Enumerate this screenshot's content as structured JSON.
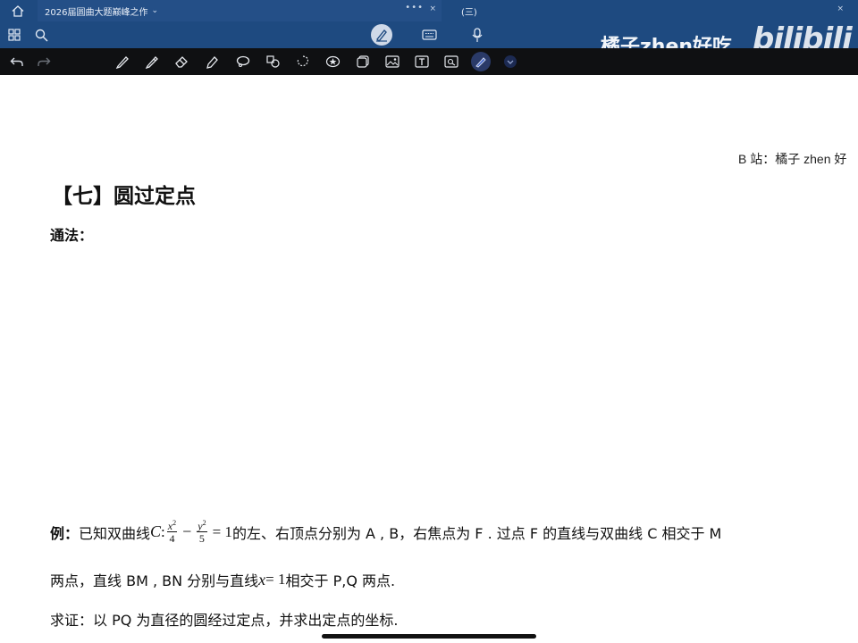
{
  "tabs": {
    "home_icon": "home-icon",
    "doc_title": "2026届圆曲大题巅峰之作",
    "doc_chevron": "⌄",
    "doc_dots": "•••",
    "doc_close": "×",
    "second_title": "(三)",
    "second_close": "×"
  },
  "nav": {
    "grid_icon": "grid-icon",
    "search_icon": "search-icon",
    "pen_mode_icon": "pen-mode-icon",
    "keyboard_icon": "keyboard-icon",
    "mic_icon": "microphone-icon"
  },
  "watermark": {
    "text": "橘子zhen好吃",
    "logo": "bilibili"
  },
  "toolbar": {
    "undo_icon": "undo-icon",
    "redo_icon": "redo-icon",
    "tools": [
      "pen-icon",
      "pencil-icon",
      "eraser-icon",
      "highlighter-icon",
      "lasso-icon",
      "shapes-icon",
      "selection-icon",
      "sticker-icon",
      "element-icon",
      "image-icon",
      "textbox-icon",
      "zoom-window-icon",
      "laser-icon"
    ],
    "colors": {
      "selected": "#1f3f8f",
      "dot_red": "#c0392b",
      "dot_blue": "#2e3f9a"
    }
  },
  "page": {
    "credit": "B 站：橘子 zhen 好",
    "section_title": "【七】圆过定点",
    "method_label": "通法：",
    "example": {
      "label": "例：",
      "line1_pre": "已知双曲线",
      "curve_name": "C",
      "colon": ":",
      "frac1_num": "x",
      "frac1_exp": "2",
      "frac1_den": "4",
      "minus": "−",
      "frac2_num": "y",
      "frac2_exp": "2",
      "frac2_den": "5",
      "equals_one": "= 1",
      "line1_post": "的左、右顶点分别为 A , B，右焦点为 F . 过点 F 的直线与双曲线 C 相交于 M",
      "line2_pre": "两点，直线 BM , BN 分别与直线",
      "line2_eq": "x",
      "line2_eq_rest": " = 1",
      "line2_post": "相交于 P,Q 两点.",
      "line3": "求证：以 PQ 为直径的圆经过定点，并求出定点的坐标."
    }
  }
}
